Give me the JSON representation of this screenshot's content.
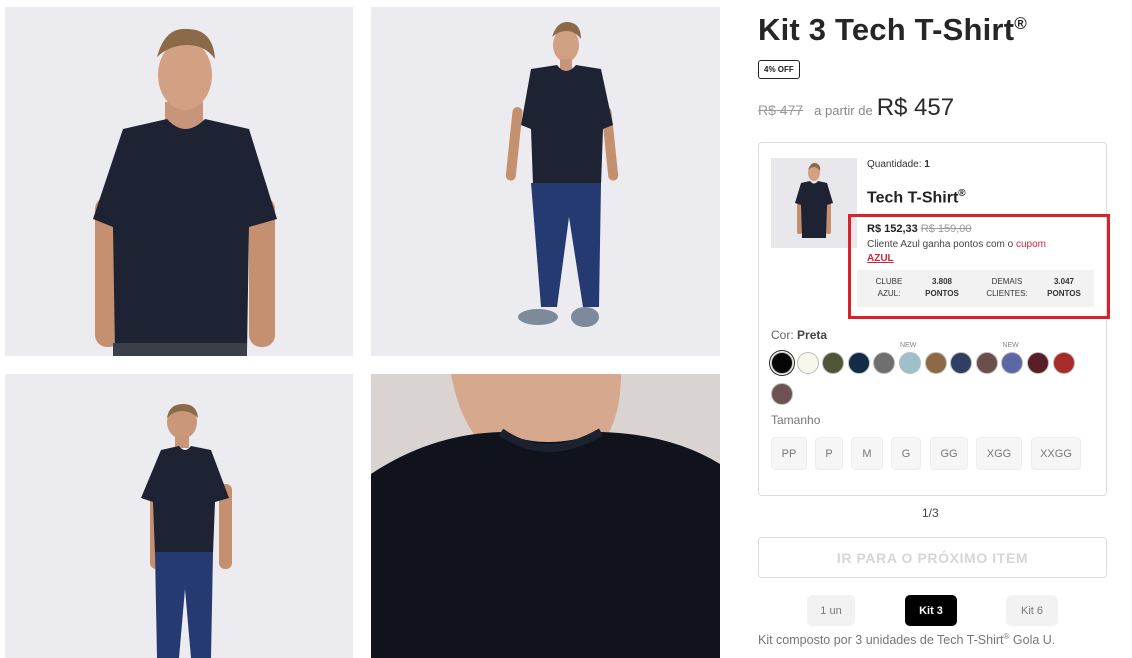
{
  "gallery": [
    {
      "name": "front-view"
    },
    {
      "name": "full-body-front"
    },
    {
      "name": "back-view"
    },
    {
      "name": "collar-detail"
    }
  ],
  "product": {
    "title": "Kit 3 Tech T-Shirt",
    "title_mark": "®",
    "discount_badge": "4% OFF",
    "old_price": "R$ 477",
    "from_label": "a partir de",
    "price": "R$ 457"
  },
  "item_card": {
    "quantity_label": "Quantidade:",
    "quantity_value": "1",
    "name": "Tech T-Shirt",
    "name_mark": "®",
    "price": "R$ 152,33",
    "old_price": "R$ 159,00",
    "azul_text": "Cliente Azul ganha pontos com o",
    "azul_coupon_prefix": "cupom",
    "azul_coupon_code": "AZUL",
    "points": {
      "club_label_1": "CLUBE",
      "club_label_2": "AZUL:",
      "club_value_1": "3.808",
      "club_value_2": "PONTOS",
      "other_label_1": "DEMAIS",
      "other_label_2": "CLIENTES:",
      "other_value_1": "3.047",
      "other_value_2": "PONTOS"
    },
    "color_label": "Cor:",
    "color_value": "Preta",
    "colors": [
      "#060606",
      "#f7f7ea",
      "#4f5537",
      "#122c48",
      "#6f6f6f",
      "#9cc0cc",
      "#8d6a45",
      "#2e3f63",
      "#6b4f4a",
      "#5c67a6",
      "#5a1e27",
      "#a72b28",
      "#6e5252"
    ],
    "new_tag": "NEW",
    "size_label": "Tamanho",
    "sizes": [
      "PP",
      "P",
      "M",
      "G",
      "GG",
      "XGG",
      "XXGG"
    ]
  },
  "pager": "1/3",
  "next_button": "IR PARA O PRÓXIMO ITEM",
  "kits": [
    {
      "label": "1 un",
      "active": false
    },
    {
      "label": "Kit 3",
      "active": true
    },
    {
      "label": "Kit 6",
      "active": false
    }
  ],
  "kit_description_prefix": "Kit composto por 3 unidades de Tech T-Shirt",
  "kit_description_mark": "®",
  "kit_description_suffix": " Gola U."
}
